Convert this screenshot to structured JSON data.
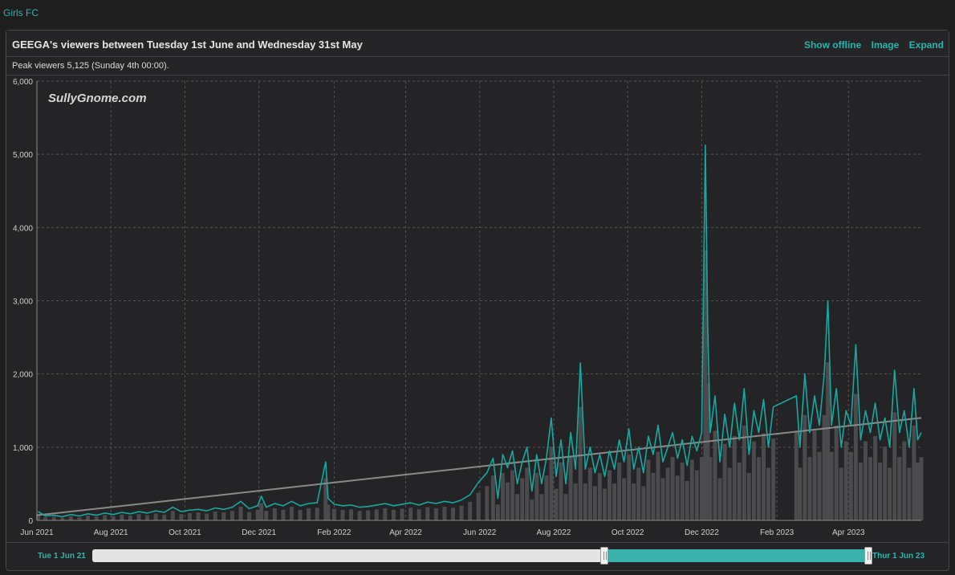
{
  "top_link": "Girls FC",
  "panel": {
    "title": "GEEGA's viewers between Tuesday 1st June and Wednesday 31st May",
    "actions": {
      "show_offline": "Show offline",
      "image": "Image",
      "expand": "Expand"
    },
    "peak_text": "Peak viewers 5,125 (Sunday 4th 00:00)."
  },
  "watermark": "SullyGnome.com",
  "range": {
    "start_label": "Tue 1 Jun 21",
    "end_label": "Thur 1 Jun 23",
    "selected_start": 0.66,
    "selected_end": 1.0
  },
  "colors": {
    "line": "#17a8a0",
    "bars": "#4b4b4d",
    "trend": "#8a8a8a",
    "accent": "#29b5ad"
  },
  "chart_data": {
    "type": "line",
    "ylim": [
      0,
      6000
    ],
    "yticks": [
      "0",
      "1,000",
      "2,000",
      "3,000",
      "4,000",
      "5,000",
      "6,000"
    ],
    "xticks": [
      "Jun 2021",
      "Aug 2021",
      "Oct 2021",
      "Dec 2021",
      "Feb 2022",
      "Apr 2022",
      "Jun 2022",
      "Aug 2022",
      "Oct 2022",
      "Dec 2022",
      "Feb 2023",
      "Apr 2023"
    ],
    "x_start": "2021-06-01",
    "x_end": "2023-05-31",
    "grid": true,
    "series": [
      {
        "values": [
          [
            "2021-06-02",
            120
          ],
          [
            "2021-06-08",
            60
          ],
          [
            "2021-06-15",
            70
          ],
          [
            "2021-06-22",
            50
          ],
          [
            "2021-06-29",
            80
          ],
          [
            "2021-07-06",
            60
          ],
          [
            "2021-07-13",
            90
          ],
          [
            "2021-07-20",
            70
          ],
          [
            "2021-07-27",
            100
          ],
          [
            "2021-08-03",
            80
          ],
          [
            "2021-08-10",
            110
          ],
          [
            "2021-08-17",
            90
          ],
          [
            "2021-08-24",
            120
          ],
          [
            "2021-08-31",
            100
          ],
          [
            "2021-09-07",
            130
          ],
          [
            "2021-09-14",
            110
          ],
          [
            "2021-09-21",
            180
          ],
          [
            "2021-09-28",
            120
          ],
          [
            "2021-10-05",
            140
          ],
          [
            "2021-10-12",
            150
          ],
          [
            "2021-10-19",
            130
          ],
          [
            "2021-10-26",
            170
          ],
          [
            "2021-11-02",
            150
          ],
          [
            "2021-11-09",
            180
          ],
          [
            "2021-11-16",
            260
          ],
          [
            "2021-11-23",
            160
          ],
          [
            "2021-11-30",
            200
          ],
          [
            "2021-12-03",
            330
          ],
          [
            "2021-12-07",
            180
          ],
          [
            "2021-12-14",
            230
          ],
          [
            "2021-12-21",
            200
          ],
          [
            "2021-12-28",
            260
          ],
          [
            "2022-01-04",
            200
          ],
          [
            "2022-01-11",
            230
          ],
          [
            "2022-01-18",
            240
          ],
          [
            "2022-01-25",
            800
          ],
          [
            "2022-01-27",
            300
          ],
          [
            "2022-02-01",
            220
          ],
          [
            "2022-02-08",
            200
          ],
          [
            "2022-02-15",
            210
          ],
          [
            "2022-02-22",
            180
          ],
          [
            "2022-03-01",
            190
          ],
          [
            "2022-03-08",
            210
          ],
          [
            "2022-03-15",
            230
          ],
          [
            "2022-03-22",
            200
          ],
          [
            "2022-03-29",
            220
          ],
          [
            "2022-04-05",
            240
          ],
          [
            "2022-04-12",
            210
          ],
          [
            "2022-04-19",
            250
          ],
          [
            "2022-04-26",
            230
          ],
          [
            "2022-05-03",
            260
          ],
          [
            "2022-05-10",
            240
          ],
          [
            "2022-05-17",
            280
          ],
          [
            "2022-05-24",
            350
          ],
          [
            "2022-05-31",
            520
          ],
          [
            "2022-06-07",
            650
          ],
          [
            "2022-06-12",
            850
          ],
          [
            "2022-06-16",
            300
          ],
          [
            "2022-06-20",
            900
          ],
          [
            "2022-06-24",
            720
          ],
          [
            "2022-06-28",
            950
          ],
          [
            "2022-07-02",
            500
          ],
          [
            "2022-07-06",
            800
          ],
          [
            "2022-07-10",
            1000
          ],
          [
            "2022-07-14",
            400
          ],
          [
            "2022-07-18",
            900
          ],
          [
            "2022-07-22",
            500
          ],
          [
            "2022-07-26",
            850
          ],
          [
            "2022-07-30",
            1400
          ],
          [
            "2022-08-03",
            600
          ],
          [
            "2022-08-07",
            1100
          ],
          [
            "2022-08-11",
            500
          ],
          [
            "2022-08-15",
            1200
          ],
          [
            "2022-08-19",
            700
          ],
          [
            "2022-08-23",
            2150
          ],
          [
            "2022-08-27",
            700
          ],
          [
            "2022-08-31",
            1000
          ],
          [
            "2022-09-04",
            650
          ],
          [
            "2022-09-08",
            900
          ],
          [
            "2022-09-12",
            600
          ],
          [
            "2022-09-16",
            950
          ],
          [
            "2022-09-20",
            700
          ],
          [
            "2022-09-24",
            1100
          ],
          [
            "2022-09-28",
            800
          ],
          [
            "2022-10-02",
            1250
          ],
          [
            "2022-10-06",
            700
          ],
          [
            "2022-10-10",
            1000
          ],
          [
            "2022-10-14",
            650
          ],
          [
            "2022-10-18",
            1150
          ],
          [
            "2022-10-22",
            900
          ],
          [
            "2022-10-26",
            1300
          ],
          [
            "2022-10-30",
            800
          ],
          [
            "2022-11-03",
            1000
          ],
          [
            "2022-11-07",
            1200
          ],
          [
            "2022-11-11",
            850
          ],
          [
            "2022-11-15",
            1100
          ],
          [
            "2022-11-19",
            750
          ],
          [
            "2022-11-23",
            1150
          ],
          [
            "2022-11-27",
            950
          ],
          [
            "2022-12-01",
            1200
          ],
          [
            "2022-12-04",
            5125
          ],
          [
            "2022-12-06",
            2600
          ],
          [
            "2022-12-08",
            1200
          ],
          [
            "2022-12-12",
            1700
          ],
          [
            "2022-12-16",
            800
          ],
          [
            "2022-12-20",
            1450
          ],
          [
            "2022-12-24",
            1000
          ],
          [
            "2022-12-28",
            1600
          ],
          [
            "2023-01-01",
            1100
          ],
          [
            "2023-01-05",
            1800
          ],
          [
            "2023-01-09",
            900
          ],
          [
            "2023-01-13",
            1500
          ],
          [
            "2023-01-17",
            1200
          ],
          [
            "2023-01-21",
            1650
          ],
          [
            "2023-01-25",
            1000
          ],
          [
            "2023-01-29",
            1550
          ],
          [
            "2023-02-17",
            1700
          ],
          [
            "2023-02-20",
            1000
          ],
          [
            "2023-02-24",
            2000
          ],
          [
            "2023-02-28",
            1200
          ],
          [
            "2023-03-04",
            1700
          ],
          [
            "2023-03-08",
            1300
          ],
          [
            "2023-03-12",
            2000
          ],
          [
            "2023-03-15",
            3000
          ],
          [
            "2023-03-18",
            1300
          ],
          [
            "2023-03-22",
            1800
          ],
          [
            "2023-03-26",
            1000
          ],
          [
            "2023-03-30",
            1500
          ],
          [
            "2023-04-03",
            1300
          ],
          [
            "2023-04-07",
            2400
          ],
          [
            "2023-04-11",
            1100
          ],
          [
            "2023-04-15",
            1500
          ],
          [
            "2023-04-19",
            1200
          ],
          [
            "2023-04-23",
            1600
          ],
          [
            "2023-04-27",
            1100
          ],
          [
            "2023-05-01",
            1400
          ],
          [
            "2023-05-05",
            1000
          ],
          [
            "2023-05-09",
            2050
          ],
          [
            "2023-05-13",
            1200
          ],
          [
            "2023-05-17",
            1500
          ],
          [
            "2023-05-21",
            1000
          ],
          [
            "2023-05-25",
            1800
          ],
          [
            "2023-05-28",
            1100
          ],
          [
            "2023-05-31",
            1200
          ]
        ]
      }
    ],
    "trend": [
      [
        "2021-06-01",
        70
      ],
      [
        "2023-05-31",
        1400
      ]
    ]
  }
}
